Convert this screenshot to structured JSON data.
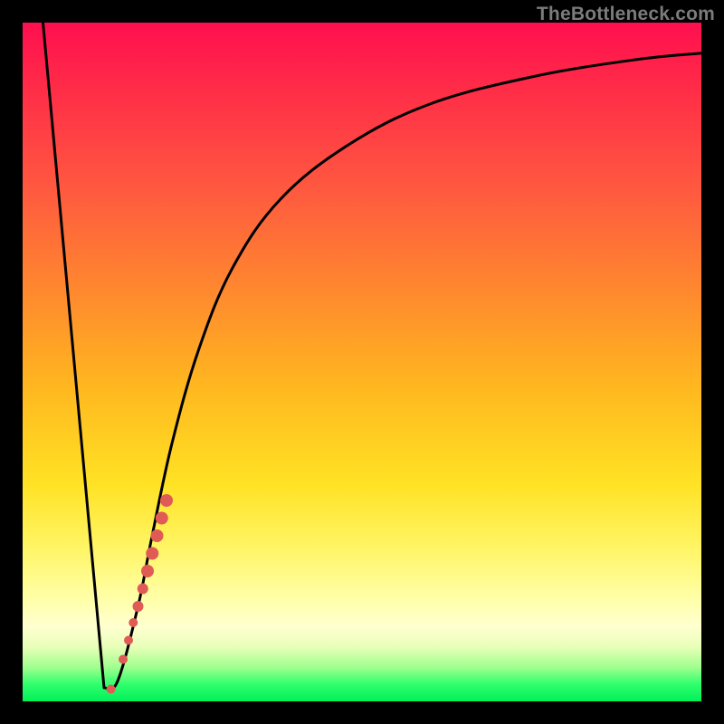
{
  "watermark": "TheBottleneck.com",
  "chart_data": {
    "type": "line",
    "title": "",
    "xlabel": "",
    "ylabel": "",
    "xlim": [
      0,
      100
    ],
    "ylim": [
      0,
      100
    ],
    "grid": false,
    "legend": false,
    "series": [
      {
        "name": "bottleneck-curve",
        "x": [
          3,
          12,
          14,
          17,
          19,
          22,
          26,
          31,
          38,
          48,
          60,
          75,
          90,
          100
        ],
        "y": [
          100,
          2,
          3,
          14,
          24,
          38,
          52,
          64,
          74,
          82,
          88,
          92,
          94.5,
          95.5
        ]
      }
    ],
    "markers": {
      "name": "highlight-dots",
      "color": "#e05b55",
      "points": [
        {
          "x": 13.0,
          "y": 1.8,
          "r": 5
        },
        {
          "x": 14.8,
          "y": 6.2,
          "r": 5
        },
        {
          "x": 15.6,
          "y": 9.0,
          "r": 5
        },
        {
          "x": 16.3,
          "y": 11.6,
          "r": 5
        },
        {
          "x": 17.0,
          "y": 14.0,
          "r": 6
        },
        {
          "x": 17.7,
          "y": 16.6,
          "r": 6
        },
        {
          "x": 18.4,
          "y": 19.2,
          "r": 7
        },
        {
          "x": 19.1,
          "y": 21.8,
          "r": 7
        },
        {
          "x": 19.8,
          "y": 24.4,
          "r": 7
        },
        {
          "x": 20.5,
          "y": 27.0,
          "r": 7
        },
        {
          "x": 21.2,
          "y": 29.6,
          "r": 7
        }
      ]
    },
    "background_gradient": {
      "top": "#ff0f4f",
      "upper_mid": "#ff8a2e",
      "mid": "#ffe224",
      "lower_mid": "#ffffa9",
      "bottom": "#00f05a"
    }
  }
}
